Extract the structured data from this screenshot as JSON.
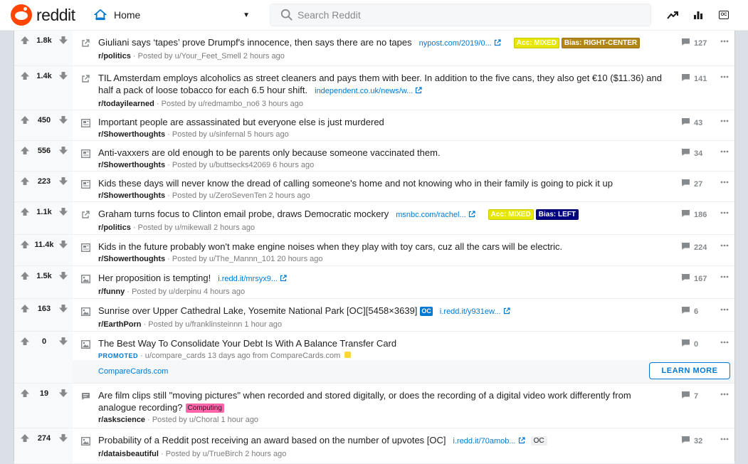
{
  "header": {
    "logo_text": "reddit",
    "feed_label": "Home",
    "search_placeholder": "Search Reddit"
  },
  "colors": {
    "accent": "#0079d3",
    "brand": "#ff4500",
    "upvote": "#878a8c"
  },
  "posts": [
    {
      "score": "1.8k",
      "thumb": "link-icon",
      "title": "Giuliani says ‘tapes’ prove Drumpf's innocence, then says there are no tapes",
      "domain": "nypost.com/2019/0...",
      "flairs": [
        "Acc: MIXED",
        "Bias: RIGHT-CENTER"
      ],
      "subreddit": "r/politics",
      "meta": "· Posted by u/Your_Feet_Smell 2 hours ago",
      "comments": "127"
    },
    {
      "score": "1.4k",
      "thumb": "link-icon",
      "title": "TIL Amsterdam employs alcoholics as street cleaners and pays them with beer. In addition to the five cans, they also get €10 ($11.36) and half a pack of loose tobacco for each 6.5 hour shift.",
      "domain": "independent.co.uk/news/w...",
      "subreddit": "r/todayilearned",
      "meta": "· Posted by u/redmambo_no6 3 hours ago",
      "comments": "141"
    },
    {
      "score": "450",
      "thumb": "text-icon",
      "title": "Important people are assassinated but everyone else is just murdered",
      "subreddit": "r/Showerthoughts",
      "meta": "· Posted by u/sinfernal 5 hours ago",
      "comments": "43"
    },
    {
      "score": "556",
      "thumb": "text-icon",
      "title": "Anti-vaxxers are old enough to be parents only because someone vaccinated them.",
      "subreddit": "r/Showerthoughts",
      "meta": "· Posted by u/buttsecks42069 6 hours ago",
      "comments": "34"
    },
    {
      "score": "223",
      "thumb": "text-icon",
      "title": "Kids these days will never know the dread of calling someone's home and not knowing who in their family is going to pick it up",
      "subreddit": "r/Showerthoughts",
      "meta": "· Posted by u/ZeroSevenTen 2 hours ago",
      "comments": "27"
    },
    {
      "score": "1.1k",
      "thumb": "link-icon",
      "title": "Graham turns focus to Clinton email probe, draws Democratic mockery",
      "domain": "msnbc.com/rachel...",
      "flairs": [
        "Acc: MIXED",
        "Bias: LEFT"
      ],
      "subreddit": "r/politics",
      "meta": "· Posted by u/mikewall 2 hours ago",
      "comments": "186"
    },
    {
      "score": "11.4k",
      "thumb": "text-icon",
      "title": "Kids in the future probably won't make engine noises when they play with toy cars, cuz all the cars will be electric.",
      "subreddit": "r/Showerthoughts",
      "meta": "· Posted by u/The_Mannn_101 20 hours ago",
      "comments": "224"
    },
    {
      "score": "1.5k",
      "thumb": "image-icon",
      "title": "Her proposition is tempting!",
      "domain": "i.redd.it/mrsyx9...",
      "subreddit": "r/funny",
      "meta": "· Posted by u/derpinu 4 hours ago",
      "comments": "167"
    },
    {
      "score": "163",
      "thumb": "image-icon",
      "title": "Sunrise over Upper Cathedral Lake, Yosemite National Park [OC][5458×3639]",
      "oc": "OC",
      "domain": "i.redd.it/y931ew...",
      "subreddit": "r/EarthPorn",
      "meta": "· Posted by u/franklinsteinnn 1 hour ago",
      "comments": "6"
    },
    {
      "score": "0",
      "thumb": "image-icon",
      "title": "The Best Way To Consolidate Your Debt Is With A Balance Transfer Card",
      "promoted": "PROMOTED",
      "meta": "· u/compare_cards 13 days ago from CompareCards.com",
      "link": "CompareCards.com",
      "cta": "LEARN MORE",
      "comments": "0"
    },
    {
      "score": "19",
      "thumb": "chat-icon",
      "title": "Are film clips still \"moving pictures\" when recorded and stored digitally, or does the recording of a digital video work differently from analogue recording?",
      "tag": "Computing",
      "subreddit": "r/askscience",
      "meta": "· Posted by u/Choral 1 hour ago",
      "comments": "7"
    },
    {
      "score": "274",
      "thumb": "image-icon",
      "title": "Probability of a Reddit post receiving an award based on the number of upvotes [OC]",
      "domain": "i.redd.it/70amob...",
      "oc2": "OC",
      "subreddit": "r/dataisbeautiful",
      "meta": "· Posted by u/TrueBirch 2 hours ago",
      "comments": "32"
    }
  ]
}
